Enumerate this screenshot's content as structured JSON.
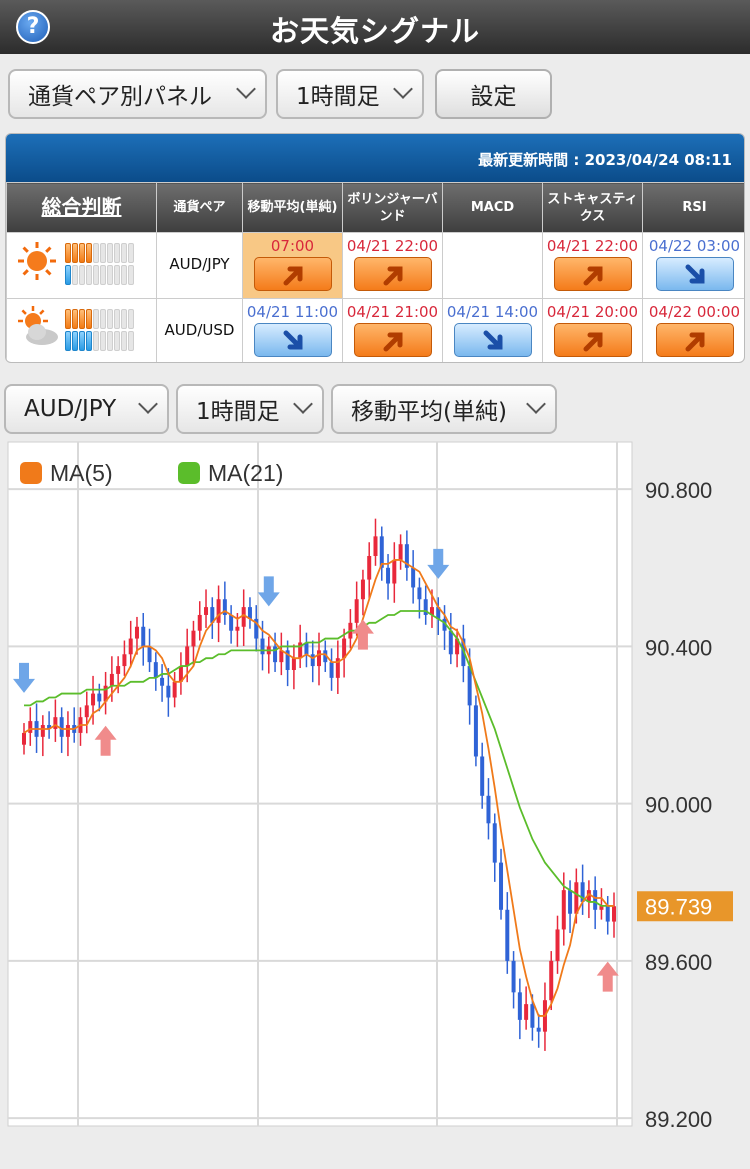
{
  "header": {
    "title": "お天気シグナル",
    "help_glyph": "?"
  },
  "controls": {
    "panel_select": "通貨ペア別パネル",
    "timeframe_select": "1時間足",
    "settings_button": "設定"
  },
  "signal_panel": {
    "updated_label": "最新更新時間 : 2023/04/24 08:11",
    "columns": [
      "総合判断",
      "通貨ペア",
      "移動平均(単純)",
      "ボリンジャーバンド",
      "MACD",
      "ストキャスティクス",
      "RSI"
    ],
    "rows": [
      {
        "pair": "AUD/JPY",
        "weather": "sunny-icon",
        "orange_bars": 4,
        "blue_bars": 1,
        "cells": [
          {
            "time": "07:00",
            "dir": "up",
            "highlight": true
          },
          {
            "time": "04/21 22:00",
            "dir": "up"
          },
          {
            "time": "",
            "dir": ""
          },
          {
            "time": "04/21 22:00",
            "dir": "up"
          },
          {
            "time": "04/22 03:00",
            "dir": "down"
          }
        ]
      },
      {
        "pair": "AUD/USD",
        "weather": "partly-cloudy-icon",
        "orange_bars": 4,
        "blue_bars": 4,
        "cells": [
          {
            "time": "04/21 11:00",
            "dir": "down"
          },
          {
            "time": "04/21 21:00",
            "dir": "up"
          },
          {
            "time": "04/21 14:00",
            "dir": "down"
          },
          {
            "time": "04/21 20:00",
            "dir": "up"
          },
          {
            "time": "04/22 00:00",
            "dir": "up"
          }
        ]
      }
    ]
  },
  "chart_controls": {
    "pair_select": "AUD/JPY",
    "timeframe_select": "1時間足",
    "indicator_select": "移動平均(単純)"
  },
  "chart_data": {
    "type": "candlestick",
    "legend": [
      {
        "name": "MA(5)",
        "color": "#f07a1a"
      },
      {
        "name": "MA(21)",
        "color": "#5bbd2b"
      }
    ],
    "y_ticks": [
      "90.800",
      "90.400",
      "90.000",
      "89.600",
      "89.200"
    ],
    "ylim": [
      89.18,
      90.92
    ],
    "current_price": "89.739",
    "up_color": "#e8283b",
    "down_color": "#2f63d6",
    "closes": [
      90.18,
      90.21,
      90.17,
      90.2,
      90.19,
      90.22,
      90.17,
      90.2,
      90.18,
      90.22,
      90.25,
      90.28,
      90.26,
      90.3,
      90.33,
      90.35,
      90.38,
      90.42,
      90.45,
      90.4,
      90.36,
      90.32,
      90.3,
      90.27,
      90.31,
      90.35,
      90.4,
      90.44,
      90.48,
      90.5,
      90.46,
      90.52,
      90.48,
      90.44,
      90.45,
      90.5,
      90.47,
      90.42,
      90.38,
      90.4,
      90.36,
      90.39,
      90.34,
      90.37,
      90.41,
      90.38,
      90.35,
      90.39,
      90.36,
      90.32,
      90.37,
      90.42,
      90.46,
      90.52,
      90.57,
      90.63,
      90.68,
      90.6,
      90.56,
      90.62,
      90.66,
      90.6,
      90.55,
      90.52,
      90.48,
      90.5,
      90.47,
      90.44,
      90.38,
      90.42,
      90.35,
      90.25,
      90.12,
      90.02,
      89.95,
      89.85,
      89.73,
      89.6,
      89.52,
      89.45,
      89.49,
      89.43,
      89.42,
      89.5,
      89.6,
      89.68,
      89.78,
      89.72,
      89.8,
      89.75,
      89.78,
      89.73,
      89.74,
      89.7,
      89.739
    ],
    "ma5": [
      90.18,
      90.19,
      90.19,
      90.19,
      90.19,
      90.2,
      90.19,
      90.19,
      90.19,
      90.2,
      90.2,
      90.23,
      90.24,
      90.26,
      90.28,
      90.3,
      90.32,
      90.35,
      90.39,
      90.4,
      90.4,
      90.39,
      90.37,
      90.33,
      90.31,
      90.31,
      90.33,
      90.35,
      90.4,
      90.44,
      90.46,
      90.48,
      90.49,
      90.48,
      90.47,
      90.48,
      90.47,
      90.46,
      90.44,
      90.43,
      90.41,
      90.39,
      90.38,
      90.37,
      90.37,
      90.38,
      90.37,
      90.38,
      90.38,
      90.36,
      90.36,
      90.37,
      90.39,
      90.42,
      90.47,
      90.52,
      90.57,
      90.61,
      90.61,
      90.62,
      90.62,
      90.61,
      90.6,
      90.59,
      90.56,
      90.53,
      90.5,
      90.48,
      90.45,
      90.44,
      90.41,
      90.37,
      90.3,
      90.23,
      90.14,
      90.04,
      89.93,
      89.83,
      89.73,
      89.63,
      89.56,
      89.5,
      89.46,
      89.46,
      89.49,
      89.53,
      89.59,
      89.64,
      89.72,
      89.75,
      89.77,
      89.76,
      89.76,
      89.74,
      89.74
    ],
    "ma21": [
      90.25,
      90.25,
      90.26,
      90.26,
      90.27,
      90.27,
      90.28,
      90.28,
      90.28,
      90.28,
      90.29,
      90.29,
      90.29,
      90.29,
      90.3,
      90.3,
      90.3,
      90.31,
      90.31,
      90.31,
      90.32,
      90.32,
      90.33,
      90.33,
      90.34,
      90.35,
      90.35,
      90.36,
      90.36,
      90.37,
      90.37,
      90.38,
      90.38,
      90.39,
      90.39,
      90.39,
      90.39,
      90.39,
      90.39,
      90.39,
      90.39,
      90.4,
      90.4,
      90.4,
      90.4,
      90.41,
      90.41,
      90.41,
      90.42,
      90.42,
      90.42,
      90.43,
      90.44,
      90.44,
      90.45,
      90.46,
      90.46,
      90.47,
      90.48,
      90.48,
      90.49,
      90.49,
      90.49,
      90.49,
      90.49,
      90.48,
      90.47,
      90.46,
      90.44,
      90.42,
      90.39,
      90.35,
      90.31,
      90.27,
      90.23,
      90.19,
      90.14,
      90.09,
      90.04,
      89.99,
      89.95,
      89.91,
      89.88,
      89.85,
      89.83,
      89.81,
      89.79,
      89.78,
      89.77,
      89.76,
      89.75,
      89.75,
      89.74,
      89.74,
      89.74
    ],
    "signals": [
      {
        "index": 0,
        "dir": "down"
      },
      {
        "index": 13,
        "dir": "up"
      },
      {
        "index": 39,
        "dir": "down"
      },
      {
        "index": 54,
        "dir": "up"
      },
      {
        "index": 66,
        "dir": "down"
      },
      {
        "index": 93,
        "dir": "up"
      }
    ]
  }
}
